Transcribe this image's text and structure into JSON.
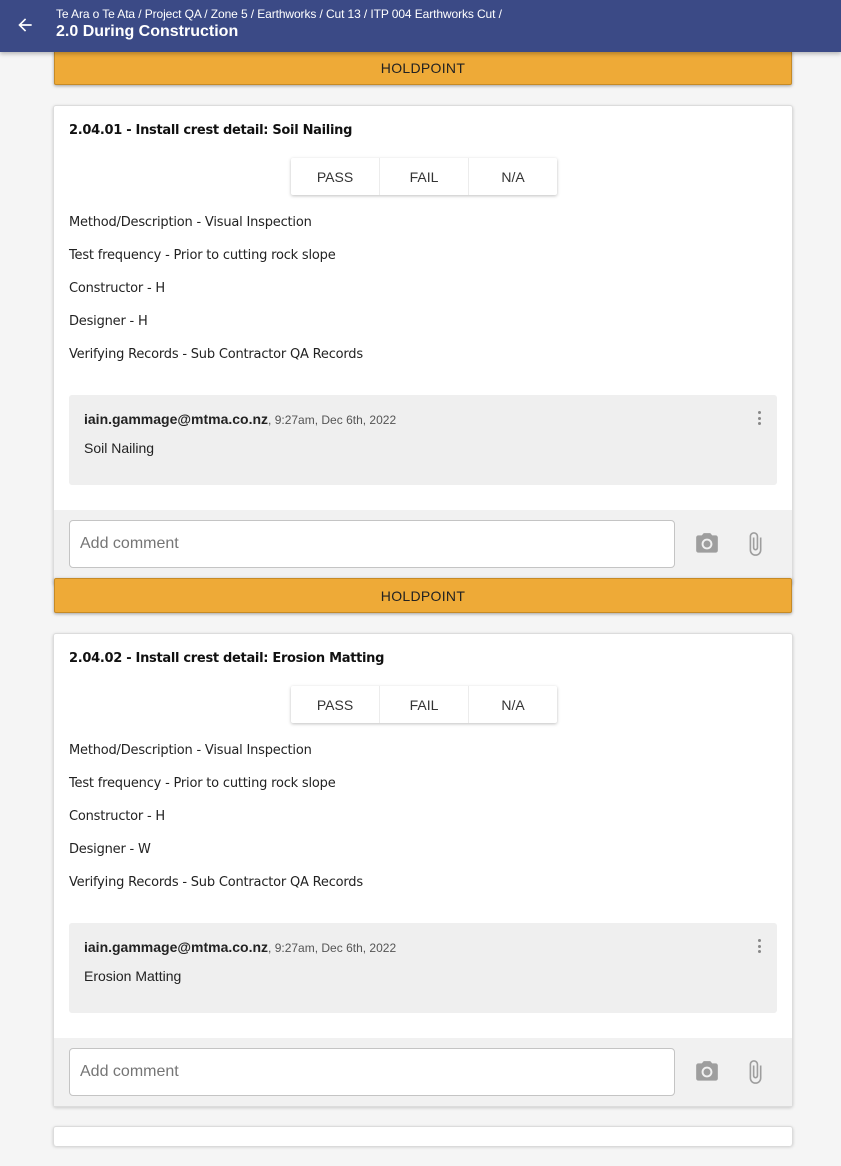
{
  "header": {
    "breadcrumb": "Te Ara o Te Ata / Project QA / Zone 5 / Earthworks / Cut 13 / ITP 004 Earthworks Cut /",
    "title": "2.0 During Construction",
    "back_icon": "arrow-left-icon"
  },
  "colors": {
    "appbar": "#3b4a86",
    "holdpoint": "#eeaa37"
  },
  "holdpoint_label": "HOLDPOINT",
  "result_options": [
    "PASS",
    "FAIL",
    "N/A"
  ],
  "items": [
    {
      "title": "2.04.01 - Install crest detail: Soil Nailing",
      "details": [
        "Method/Description - Visual Inspection",
        "Test frequency - Prior to cutting rock slope",
        "Constructor - H",
        "Designer - H",
        "Verifying Records - Sub Contractor QA Records"
      ],
      "comment": {
        "author": "iain.gammage@mtma.co.nz",
        "time": ", 9:27am, Dec 6th, 2022",
        "text": "Soil Nailing"
      },
      "input_placeholder": "Add comment"
    },
    {
      "title": "2.04.02 - Install crest detail: Erosion Matting",
      "details": [
        "Method/Description - Visual Inspection",
        "Test frequency - Prior to cutting rock slope",
        "Constructor - H",
        "Designer - W",
        "Verifying Records - Sub Contractor QA Records"
      ],
      "comment": {
        "author": "iain.gammage@mtma.co.nz",
        "time": ", 9:27am, Dec 6th, 2022",
        "text": "Erosion Matting"
      },
      "input_placeholder": "Add comment"
    }
  ],
  "footer_icons": [
    "camera-icon",
    "paperclip-icon"
  ]
}
